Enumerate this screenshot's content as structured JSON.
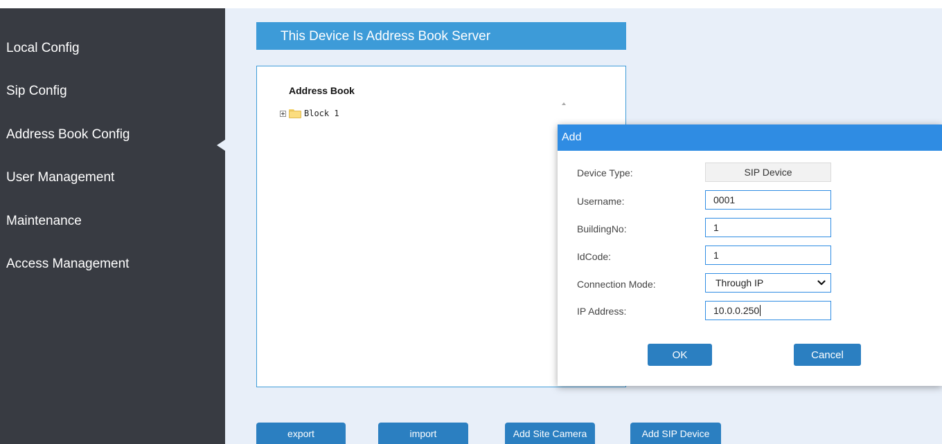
{
  "sidebar": {
    "items": [
      {
        "label": "Local Config"
      },
      {
        "label": "Sip Config"
      },
      {
        "label": "Address Book Config"
      },
      {
        "label": "User Management"
      },
      {
        "label": "Maintenance"
      },
      {
        "label": "Access Management"
      }
    ],
    "active_index": 2
  },
  "banner": {
    "title": "This Device Is Address Book Server"
  },
  "address_book": {
    "title": "Address Book",
    "tree": [
      {
        "label": "Block 1",
        "icon": "folder-icon",
        "expand_icon": "plus-box-icon"
      }
    ]
  },
  "bottom_buttons": {
    "export": "export",
    "import": "import",
    "add_site_camera": "Add Site Camera",
    "add_sip_device": "Add SIP Device"
  },
  "dialog": {
    "title": "Add",
    "fields": {
      "device_type": {
        "label": "Device Type:",
        "value": "SIP Device"
      },
      "username": {
        "label": "Username:",
        "value": "0001"
      },
      "building_no": {
        "label": "BuildingNo:",
        "value": "1"
      },
      "id_code": {
        "label": "IdCode:",
        "value": "1"
      },
      "connection_mode": {
        "label": "Connection Mode:",
        "value": "Through IP"
      },
      "ip_address": {
        "label": "IP Address:",
        "value": "10.0.0.250"
      }
    },
    "ok_label": "OK",
    "cancel_label": "Cancel"
  },
  "colors": {
    "sidebar_bg": "#383b42",
    "page_bg": "#e8eff9",
    "banner_bg": "#3d9bd8",
    "dialog_header": "#2f8ce3",
    "button_bg": "#2b7fc1"
  }
}
